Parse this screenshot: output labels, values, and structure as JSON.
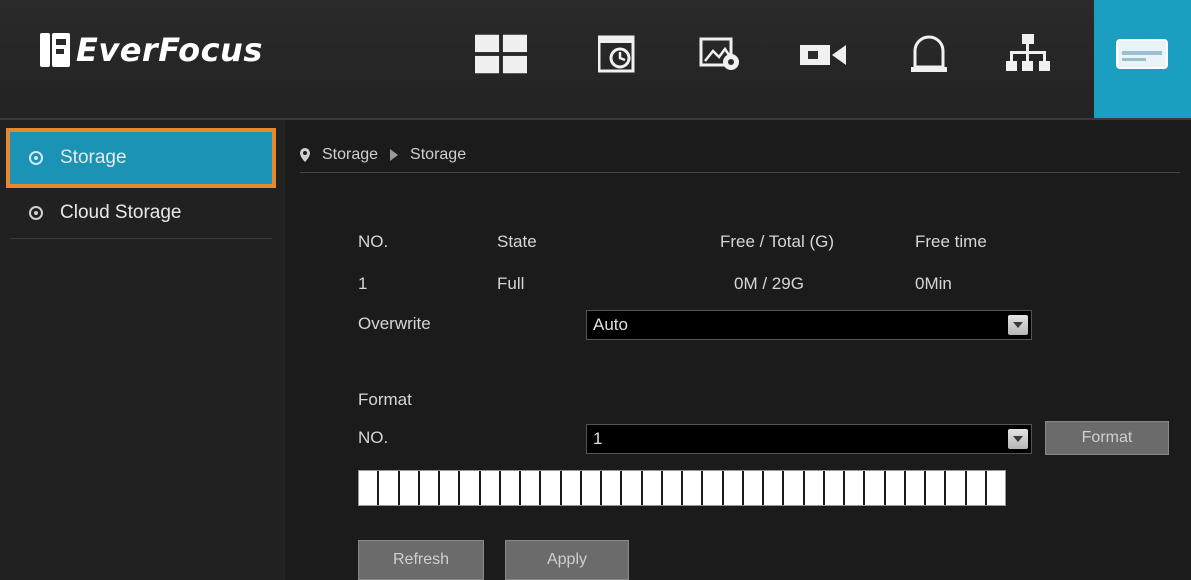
{
  "header": {
    "logo_text": "EverFocus",
    "nav_icons": [
      "live-view-icon",
      "playback-icon",
      "image-settings-icon",
      "camera-icon",
      "alarm-icon",
      "network-icon",
      "storage-icon"
    ],
    "active_color": "#1b9fc0"
  },
  "sidebar": {
    "items": [
      {
        "label": "Storage",
        "active": true
      },
      {
        "label": "Cloud Storage",
        "active": false
      }
    ],
    "active_color": "#1b93b4",
    "highlight_color": "#e5882e"
  },
  "breadcrumb": {
    "parent": "Storage",
    "current": "Storage"
  },
  "table": {
    "headers": [
      "NO.",
      "State",
      "Free / Total (G)",
      "Free time"
    ],
    "rows": [
      [
        "1",
        "Full",
        "0M / 29G",
        "0Min"
      ]
    ]
  },
  "overwrite": {
    "label": "Overwrite",
    "value": "Auto"
  },
  "format": {
    "section_label": "Format",
    "no_label": "NO.",
    "no_value": "1",
    "button_label": "Format"
  },
  "actions": {
    "refresh_label": "Refresh",
    "apply_label": "Apply"
  }
}
